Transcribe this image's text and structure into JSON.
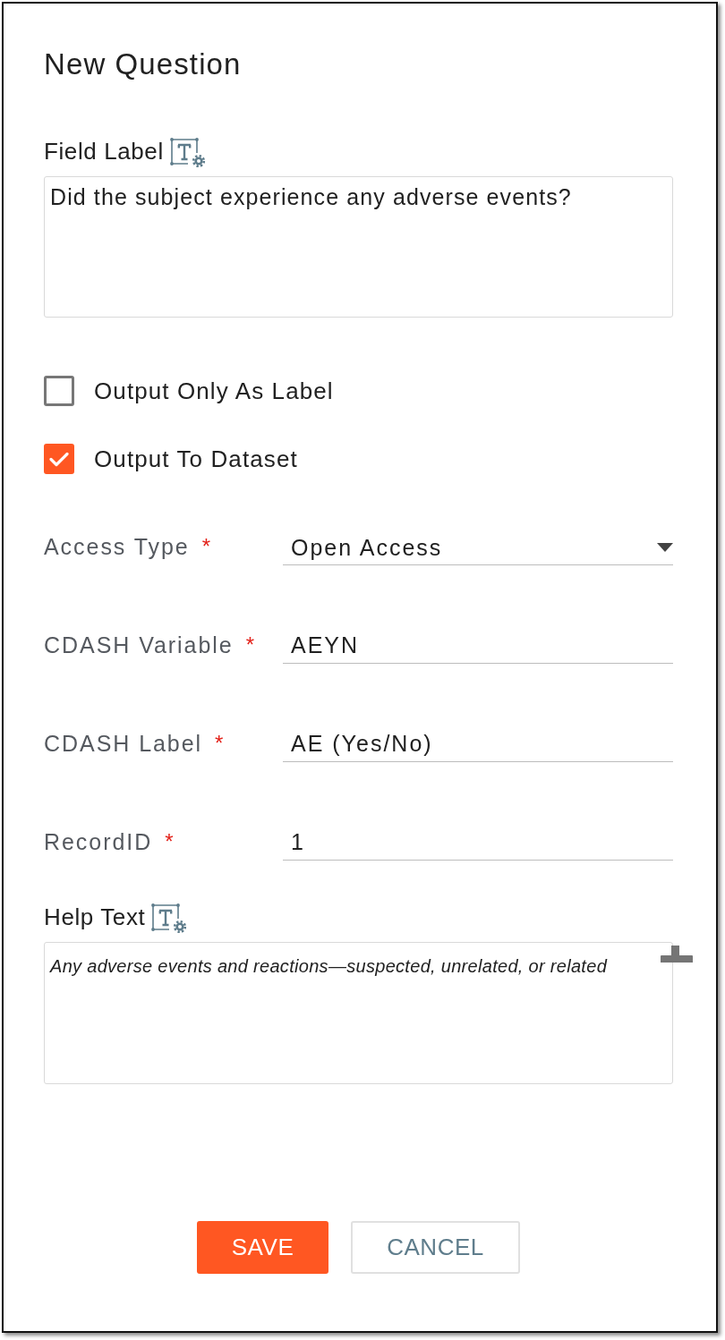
{
  "dialog": {
    "title": "New Question"
  },
  "field_label": {
    "label": "Field Label",
    "value": "Did the subject experience any adverse events?"
  },
  "options": [
    {
      "label": "Output Only As Label",
      "checked": false
    },
    {
      "label": "Output To Dataset",
      "checked": true
    }
  ],
  "fields": [
    {
      "kind": "select",
      "label": "Access Type",
      "required_mark": "*",
      "value": "Open Access"
    },
    {
      "kind": "text",
      "label": "CDASH Variable",
      "required_mark": "*",
      "value": "AEYN"
    },
    {
      "kind": "text",
      "label": "CDASH Label",
      "required_mark": "*",
      "value": "AE (Yes/No)"
    },
    {
      "kind": "text",
      "label": "RecordID",
      "required_mark": "*",
      "value": "1"
    }
  ],
  "help_text": {
    "label": "Help Text",
    "value": "Any adverse events and reactions—suspected, unrelated, or related"
  },
  "buttons": [
    {
      "kind": "primary",
      "label": "SAVE"
    },
    {
      "kind": "secondary",
      "label": "CANCEL"
    }
  ]
}
